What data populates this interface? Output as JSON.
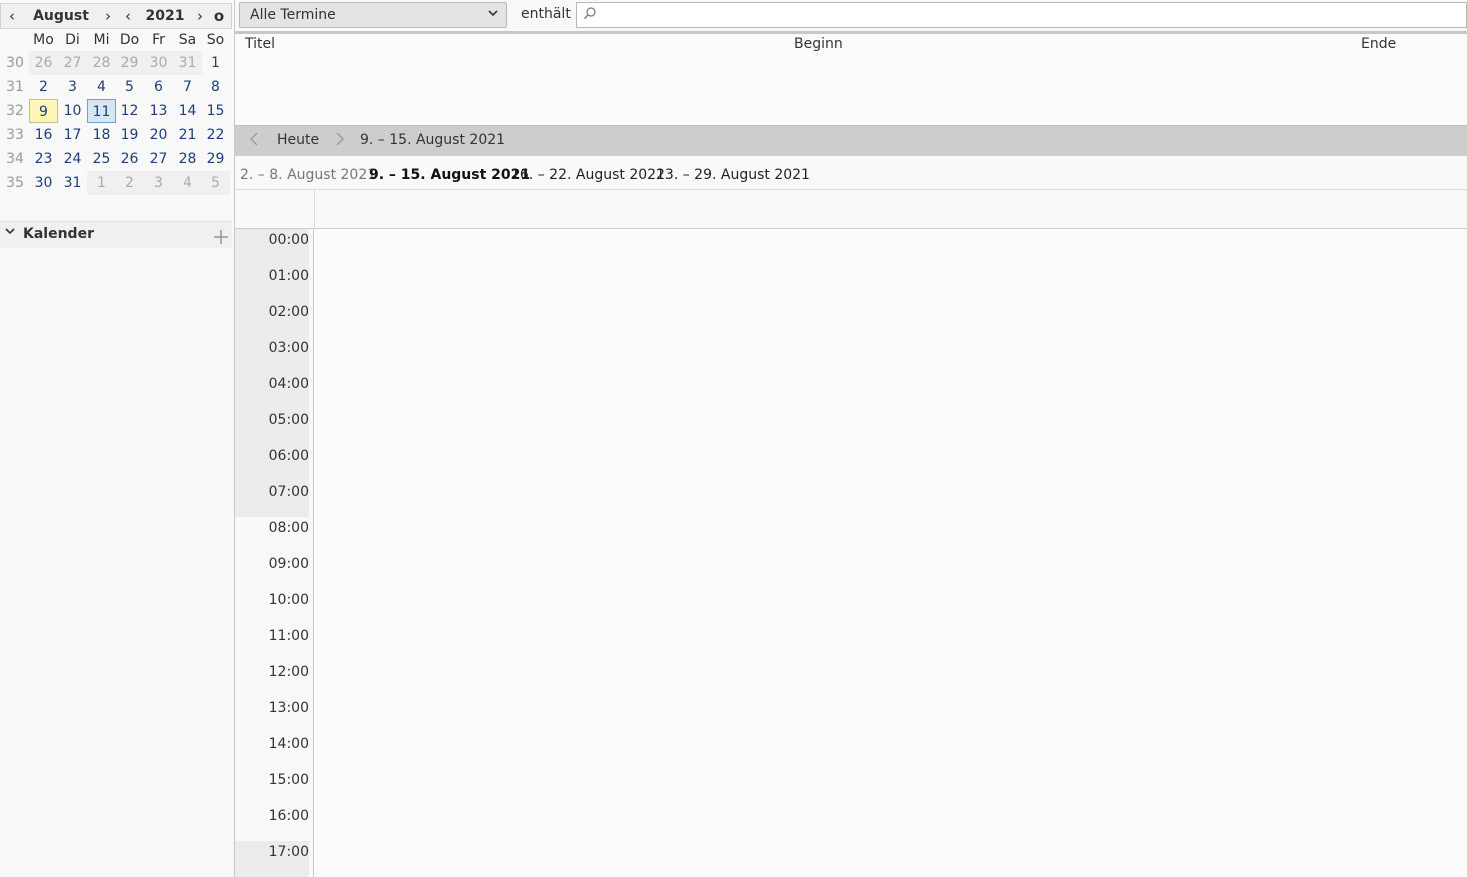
{
  "minicalendar": {
    "month": "August",
    "year": "2021",
    "prev_month": "‹",
    "next_month": "›",
    "prev_year": "‹",
    "next_year": "›",
    "today_btn": "o",
    "weekday_headers": [
      "Mo",
      "Di",
      "Mi",
      "Do",
      "Fr",
      "Sa",
      "So"
    ],
    "weeks": [
      {
        "week": "30",
        "days": [
          {
            "d": "26",
            "s": "other"
          },
          {
            "d": "27",
            "s": "other"
          },
          {
            "d": "28",
            "s": "other"
          },
          {
            "d": "29",
            "s": "other"
          },
          {
            "d": "30",
            "s": "other"
          },
          {
            "d": "31",
            "s": "other"
          },
          {
            "d": "1",
            "s": ""
          }
        ]
      },
      {
        "week": "31",
        "days": [
          {
            "d": "2",
            "s": ""
          },
          {
            "d": "3",
            "s": ""
          },
          {
            "d": "4",
            "s": ""
          },
          {
            "d": "5",
            "s": ""
          },
          {
            "d": "6",
            "s": ""
          },
          {
            "d": "7",
            "s": ""
          },
          {
            "d": "8",
            "s": ""
          }
        ]
      },
      {
        "week": "32",
        "days": [
          {
            "d": "9",
            "s": "today"
          },
          {
            "d": "10",
            "s": ""
          },
          {
            "d": "11",
            "s": "selected"
          },
          {
            "d": "12",
            "s": ""
          },
          {
            "d": "13",
            "s": ""
          },
          {
            "d": "14",
            "s": ""
          },
          {
            "d": "15",
            "s": ""
          }
        ]
      },
      {
        "week": "33",
        "days": [
          {
            "d": "16",
            "s": ""
          },
          {
            "d": "17",
            "s": ""
          },
          {
            "d": "18",
            "s": ""
          },
          {
            "d": "19",
            "s": ""
          },
          {
            "d": "20",
            "s": ""
          },
          {
            "d": "21",
            "s": ""
          },
          {
            "d": "22",
            "s": ""
          }
        ]
      },
      {
        "week": "34",
        "days": [
          {
            "d": "23",
            "s": ""
          },
          {
            "d": "24",
            "s": ""
          },
          {
            "d": "25",
            "s": ""
          },
          {
            "d": "26",
            "s": ""
          },
          {
            "d": "27",
            "s": ""
          },
          {
            "d": "28",
            "s": ""
          },
          {
            "d": "29",
            "s": ""
          }
        ]
      },
      {
        "week": "35",
        "days": [
          {
            "d": "30",
            "s": ""
          },
          {
            "d": "31",
            "s": ""
          },
          {
            "d": "1",
            "s": "other"
          },
          {
            "d": "2",
            "s": "other"
          },
          {
            "d": "3",
            "s": "other"
          },
          {
            "d": "4",
            "s": "other"
          },
          {
            "d": "5",
            "s": "other"
          }
        ]
      }
    ]
  },
  "calendar_section": {
    "title": "Kalender",
    "collapse_icon": "chevron-down-icon",
    "add_icon": "plus-icon"
  },
  "filter": {
    "selected": "Alle Termine",
    "contains_label": "enthält",
    "search_value": "",
    "search_icon": "search-icon"
  },
  "event_list": {
    "columns": [
      "Titel",
      "Beginn",
      "Ende"
    ]
  },
  "navigation": {
    "today_label": "Heute",
    "range_label": "9. – 15. August 2021"
  },
  "week_tabs": {
    "prev": "2. – 8. August 2021",
    "current": "9. – 15. August 2021",
    "next1": "16. – 22. August 2021",
    "next2": "23. – 29. August 2021"
  },
  "day_view": {
    "hours": [
      "00:00",
      "01:00",
      "02:00",
      "03:00",
      "04:00",
      "05:00",
      "06:00",
      "07:00",
      "08:00",
      "09:00",
      "10:00",
      "11:00",
      "12:00",
      "13:00",
      "14:00",
      "15:00",
      "16:00",
      "17:00"
    ],
    "off_hours_before": 8,
    "off_hours_from": 17
  },
  "colors": {
    "today_bg": "#fdf6b6",
    "selected_bg": "#d5e6f5",
    "day_link": "#1e3f7a"
  }
}
